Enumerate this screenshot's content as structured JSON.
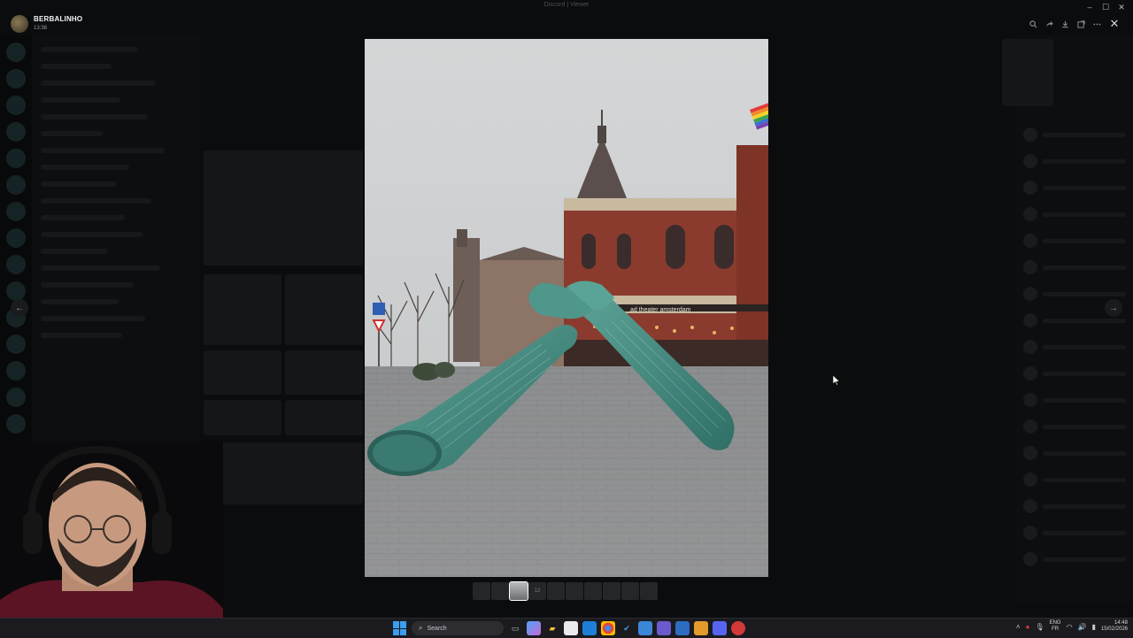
{
  "window": {
    "title": "Discord | Viewer",
    "controls": {
      "minimize": "–",
      "maximize": "☐",
      "close": "✕"
    }
  },
  "viewer": {
    "uploader_name": "BERBALINHO",
    "upload_time": "13:38",
    "tools": [
      "zoom-in-icon",
      "share-icon",
      "download-icon",
      "open-external-icon",
      "more-icon"
    ],
    "close_glyph": "✕",
    "prev_glyph": "←",
    "next_glyph": "→",
    "photo_sign_text": "ad theater amsterdam",
    "thumbnail_count": 10,
    "active_thumbnail": 3,
    "thumbnail_badge": "12"
  },
  "taskbar": {
    "search_placeholder": "Search",
    "language_top": "ENG",
    "language_bottom": "FR",
    "time": "14:48",
    "date": "15/02/2026",
    "pinned_icons": [
      "file-explorer-icon",
      "copilot-icon",
      "photos-icon",
      "task-view-icon",
      "folder-icon",
      "store-icon",
      "mail-icon",
      "chrome-icon",
      "calendar-icon",
      "teams-icon",
      "vpn-icon",
      "notes-icon",
      "discord-icon",
      "app-icon"
    ]
  },
  "colors": {
    "accent": "#3c9cf0",
    "background": "#050506",
    "statue": "#3f8b80"
  }
}
